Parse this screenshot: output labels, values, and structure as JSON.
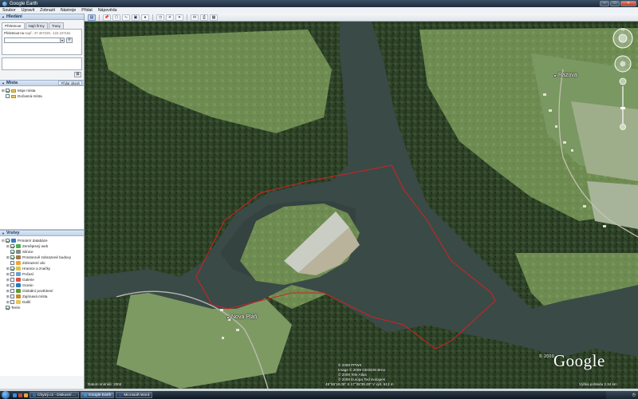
{
  "window": {
    "title": "Google Earth",
    "buttons": [
      "–",
      "□",
      "×"
    ]
  },
  "menu": [
    "Soubor",
    "Upravit",
    "Zobrazit",
    "Nástroje",
    "Přidat",
    "Nápověda"
  ],
  "toolbar": {
    "icons": [
      "sidebar-toggle-icon",
      "placemark-icon",
      "polygon-icon",
      "path-icon",
      "overlay-icon",
      "tour-icon",
      "history-icon",
      "sun-icon",
      "sky-icon",
      "email-icon",
      "print-icon",
      "maps-icon"
    ]
  },
  "search": {
    "header": "Hledání",
    "tabs": [
      "Přeletnout",
      "Najít firmy",
      "Trasy"
    ],
    "fly_label": "Přeletnout na",
    "fly_hint": "např.: 37.407229, -122.107161",
    "input_value": ""
  },
  "places": {
    "header": "Místa",
    "add_button": "Přidat obsah",
    "items": [
      {
        "label": "Moje místa",
        "checked": true
      },
      {
        "label": "Dočasná místa",
        "checked": false
      }
    ]
  },
  "layers": {
    "header": "Vrstvy",
    "items": [
      {
        "label": "Primární databáze",
        "color": "#3b79c4"
      },
      {
        "label": "Zeměpisný web",
        "color": "#4caf50"
      },
      {
        "label": "Silnice",
        "color": "#8a8a8a"
      },
      {
        "label": "Prostorově zobrazené budovy",
        "color": "#9a7b4f"
      },
      {
        "label": "Zobrazení ulic",
        "color": "#f3a33b"
      },
      {
        "label": "Hranice a značky",
        "color": "#e5c04a"
      },
      {
        "label": "Počasí",
        "color": "#6aa0d8"
      },
      {
        "label": "Galerie",
        "color": "#d9534f"
      },
      {
        "label": "Oceán",
        "color": "#2a7ab8"
      },
      {
        "label": "Globální povědomí",
        "color": "#5a9b3a"
      },
      {
        "label": "Zajímavá místa",
        "color": "#c58a2a"
      },
      {
        "label": "Další",
        "color": "#e8c55a"
      },
      {
        "label": "Terén",
        "color": "#9bb35b"
      }
    ]
  },
  "map": {
    "place_labels": [
      "Razová",
      "Nová Pláň"
    ],
    "image_date": "Datum snímků: 2004",
    "copyright": [
      "© 2009 PPWK",
      "Image © 2009 GEODIS Brno",
      "© 2009 Tele Atlas",
      "© 2009 Europa Technologies"
    ],
    "coords": "49°55'18.06\" S    17°28'39.28\" V    výš. 513 m",
    "eye_alt": "Výška pohledu 2.34 km",
    "logo": "Google",
    "logo_year": "© 2009"
  },
  "taskbar": {
    "tasks": [
      {
        "label": "Chytrý.cz - Diskusní ...",
        "color": "#2a6fbf",
        "active": false
      },
      {
        "label": "Google Earth",
        "color": "#3f93d8",
        "active": true
      },
      {
        "label": "Microsoft Word",
        "color": "#2b579a",
        "active": false
      }
    ]
  }
}
